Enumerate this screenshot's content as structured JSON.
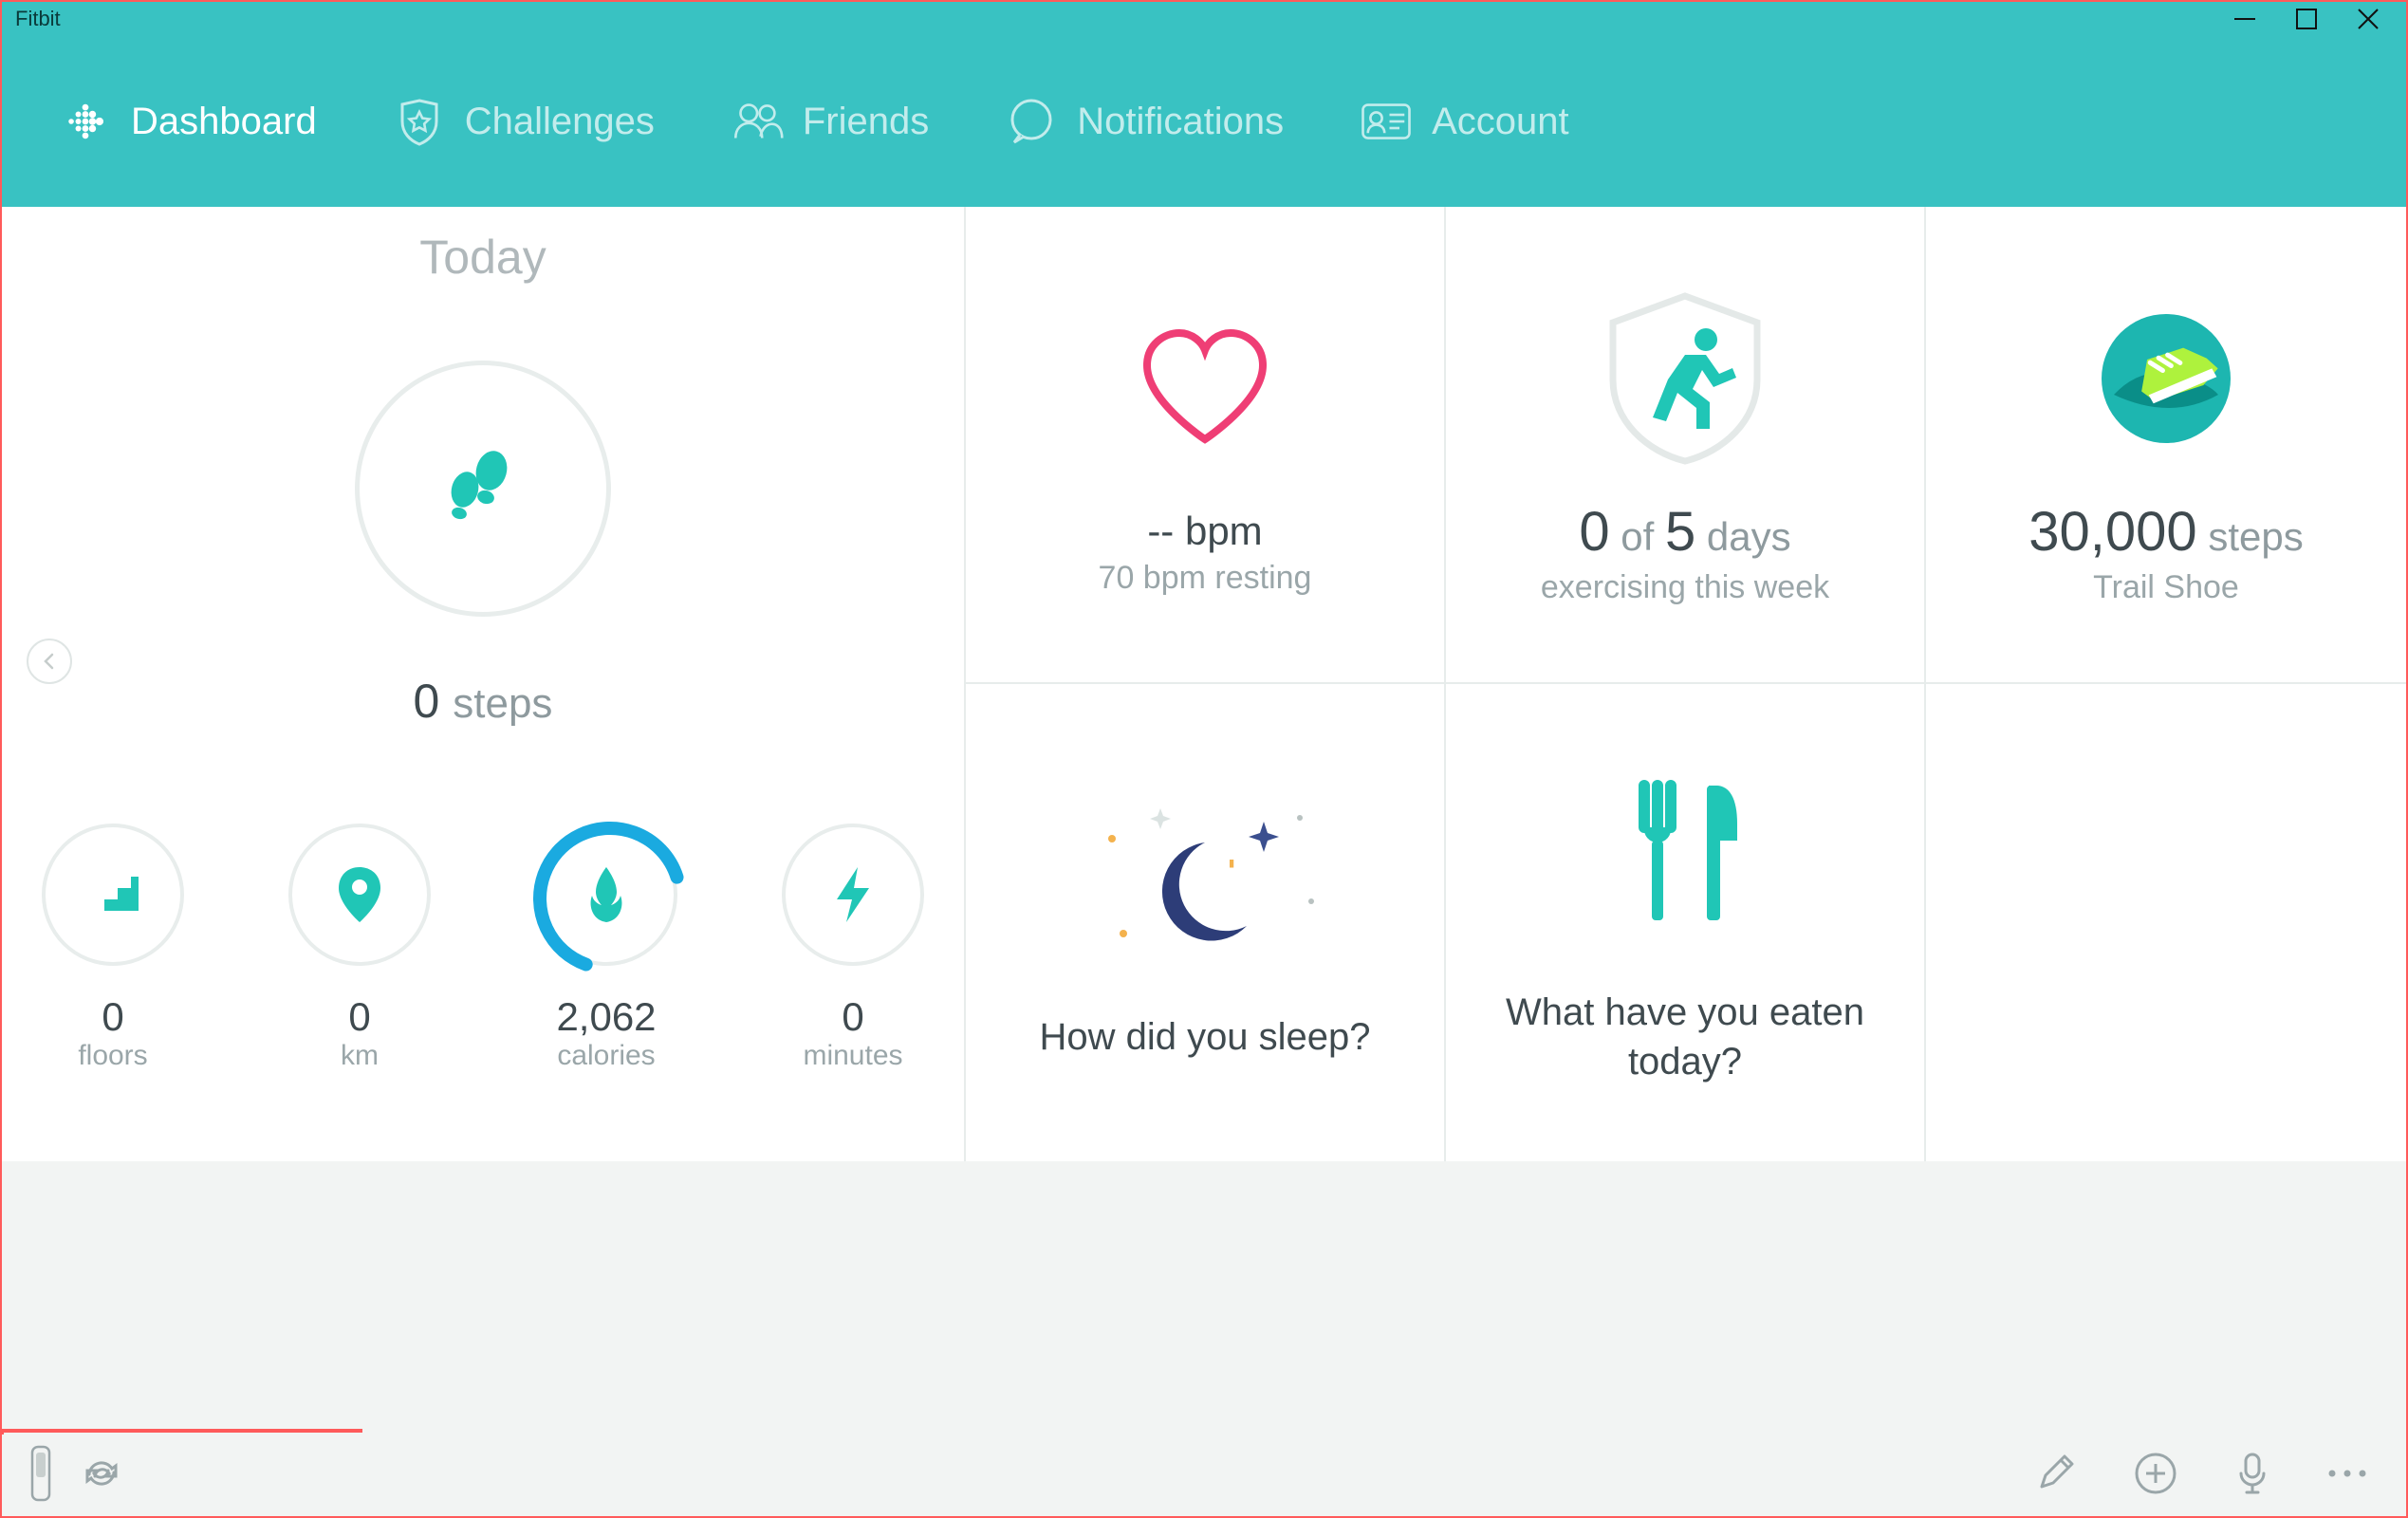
{
  "window": {
    "title": "Fitbit"
  },
  "nav": {
    "items": [
      {
        "label": "Dashboard"
      },
      {
        "label": "Challenges"
      },
      {
        "label": "Friends"
      },
      {
        "label": "Notifications"
      },
      {
        "label": "Account"
      }
    ]
  },
  "today": {
    "title": "Today",
    "steps_value": "0",
    "steps_unit": "steps",
    "mini": [
      {
        "value": "0",
        "label": "floors"
      },
      {
        "value": "0",
        "label": "km"
      },
      {
        "value": "2,062",
        "label": "calories"
      },
      {
        "value": "0",
        "label": "minutes"
      }
    ]
  },
  "tiles": {
    "heart": {
      "line1": "--  bpm",
      "line2": "70 bpm resting"
    },
    "exercise": {
      "val0": "0",
      "of": "of",
      "val5": "5",
      "days": "days",
      "line2": "exercising this week"
    },
    "badge": {
      "line1": "30,000",
      "unit": "steps",
      "line2": "Trail Shoe"
    },
    "sleep": {
      "prompt": "How did you sleep?"
    },
    "food": {
      "prompt": "What have you eaten today?"
    }
  }
}
